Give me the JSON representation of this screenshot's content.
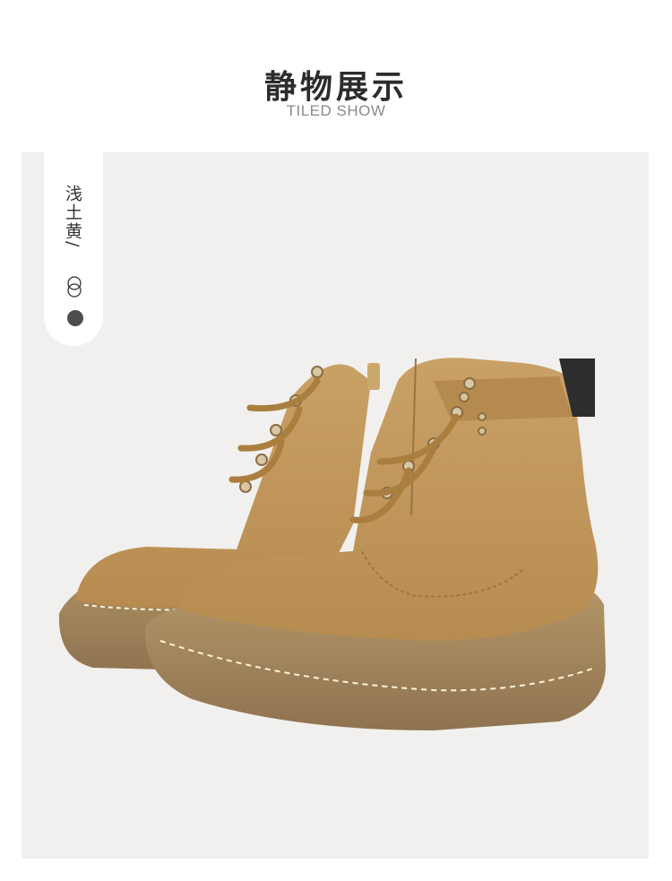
{
  "header": {
    "title": "静物展示",
    "subtitle": "TILED SHOW"
  },
  "color_tag": {
    "label": "浅土黄/",
    "icons": [
      "double-circle-icon",
      "filled-circle-icon"
    ]
  },
  "product": {
    "name": "ankle boot",
    "colors": {
      "suede": "#c49a5a",
      "sole": "#a98a61",
      "background": "#f1f0ee"
    }
  }
}
